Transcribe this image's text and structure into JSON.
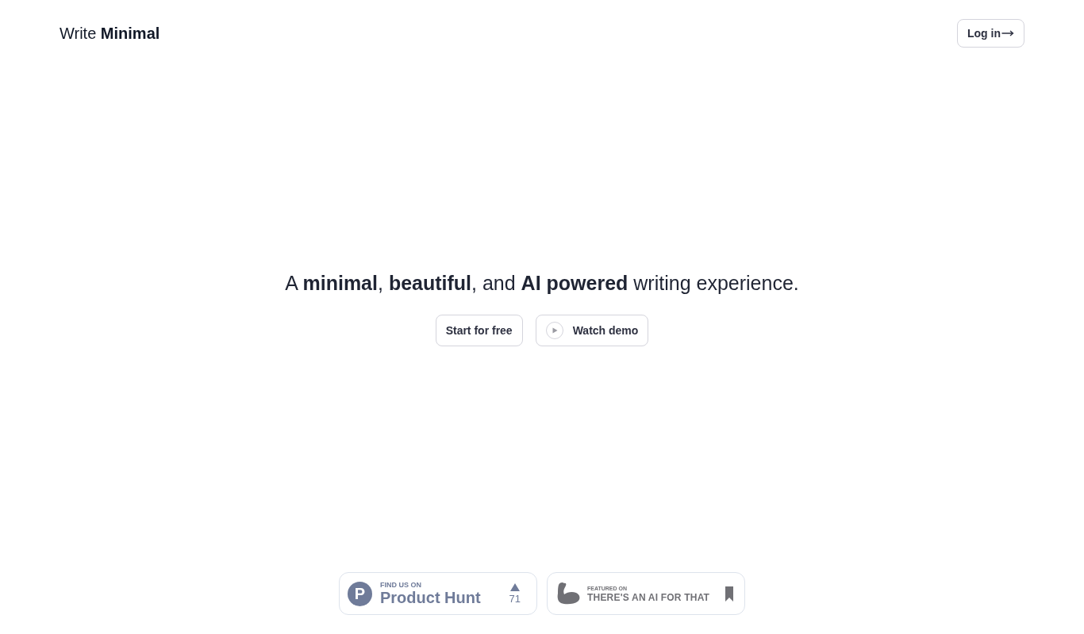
{
  "header": {
    "logo": "Write **Minimal**",
    "login_button": "Log in"
  },
  "hero": {
    "headline": "A **minimal**, **beautiful**, and **AI powered** writing experience.",
    "buttons": [
      {
        "kind": "plain",
        "label": "Start for free"
      },
      {
        "kind": "play",
        "label": "Watch demo"
      }
    ]
  },
  "badges": [
    {
      "kind": "product_hunt",
      "logo": "P",
      "overline": "FIND US ON",
      "name": "Product Hunt",
      "count": "71"
    },
    {
      "kind": "featured",
      "overline": "FEATURED ON",
      "name": "THERE'S AN AI FOR THAT"
    }
  ]
}
